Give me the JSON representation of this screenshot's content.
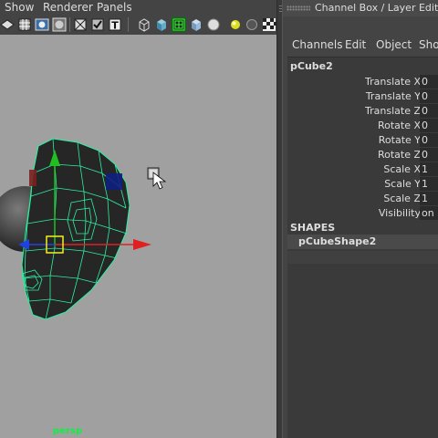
{
  "viewport": {
    "menus": [
      "Show",
      "Renderer",
      "Panels"
    ],
    "camera_label": "persp",
    "toolbar_icons": [
      "select-camera-icon",
      "grid-toggle-icon",
      "film-gate-icon",
      "resolution-gate-icon",
      "wireframe-icon",
      "smooth-shade-icon",
      "xray-icon",
      "textured-icon",
      "isolate-select-icon",
      "wireframe-on-shaded-icon",
      "default-material-icon",
      "use-all-lights-icon",
      "shadows-icon",
      "ambient-occlusion-icon"
    ]
  },
  "channel_box": {
    "title": "Channel Box / Layer Editor",
    "menus": [
      "Channels",
      "Edit",
      "Object",
      "Show"
    ],
    "object_name": "pCube2",
    "attributes": [
      {
        "label": "Translate X",
        "value": "0"
      },
      {
        "label": "Translate Y",
        "value": "0"
      },
      {
        "label": "Translate Z",
        "value": "0"
      },
      {
        "label": "Rotate X",
        "value": "0"
      },
      {
        "label": "Rotate Y",
        "value": "0"
      },
      {
        "label": "Rotate Z",
        "value": "0"
      },
      {
        "label": "Scale X",
        "value": "1"
      },
      {
        "label": "Scale Y",
        "value": "1"
      },
      {
        "label": "Scale Z",
        "value": "1"
      },
      {
        "label": "Visibility",
        "value": "on"
      }
    ],
    "shapes_header": "SHAPES",
    "shape_name": "pCubeShape2"
  },
  "colors": {
    "viewport_bg": "#a0a0a0",
    "selection_wireframe": "#2cf0a0",
    "manipulator_x": "#e02020",
    "manipulator_y": "#20c020",
    "manipulator_z": "#2040e0",
    "camera_label": "#22ee44"
  }
}
